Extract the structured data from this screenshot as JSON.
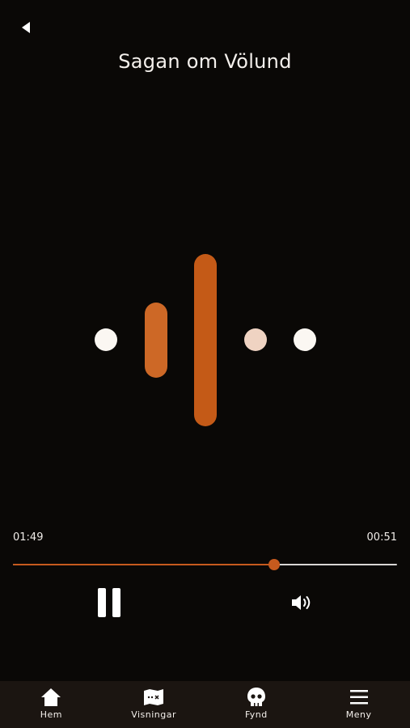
{
  "header": {
    "back_icon": "back-arrow-icon",
    "title": "Sagan om Völund"
  },
  "visualizer": {
    "colors": {
      "dot_white": "#fbf7f2",
      "dot_light": "#efd3c2",
      "bar_orange": "#c45a17",
      "bar_orange_soft": "#cd6826"
    }
  },
  "player": {
    "elapsed": "01:49",
    "remaining": "00:51",
    "progress_fraction": 0.68,
    "colors": {
      "played": "#c65a1e",
      "unplayed": "#d8d6d4"
    },
    "pause_icon": "pause-icon",
    "volume_icon": "volume-icon"
  },
  "tabbar": {
    "items": [
      {
        "label": "Hem",
        "icon": "home-icon"
      },
      {
        "label": "Visningar",
        "icon": "map-icon"
      },
      {
        "label": "Fynd",
        "icon": "skull-icon"
      },
      {
        "label": "Meny",
        "icon": "menu-icon"
      }
    ]
  }
}
